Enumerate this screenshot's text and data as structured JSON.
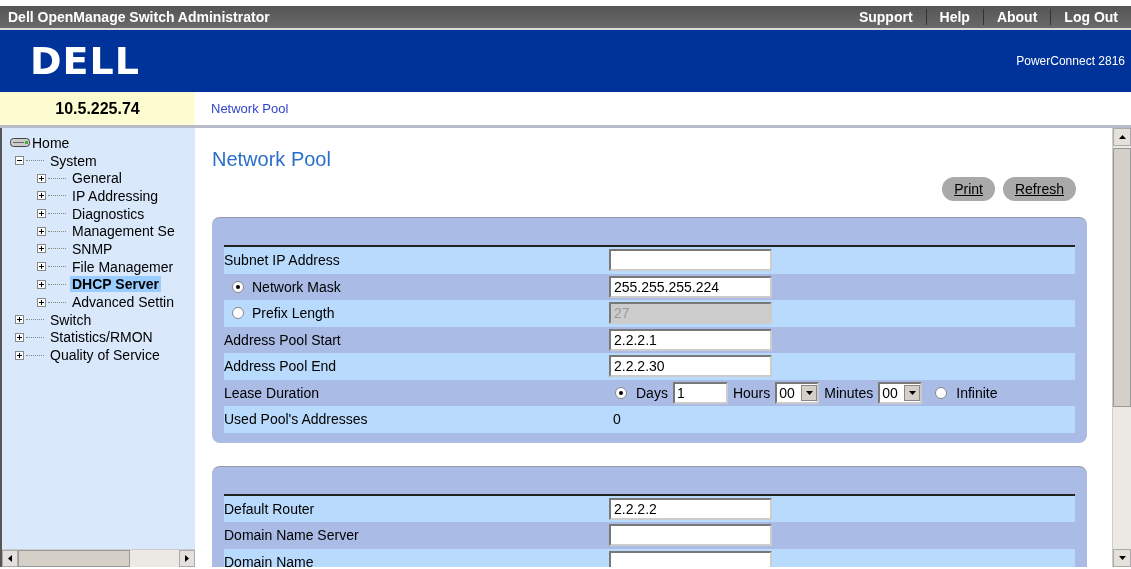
{
  "title_bar": {
    "title": "Dell OpenManage Switch Administrator",
    "links": [
      "Support",
      "Help",
      "About",
      "Log Out"
    ]
  },
  "header": {
    "logo": "DELL",
    "model": "PowerConnect 2816"
  },
  "device_ip": "10.5.225.74",
  "breadcrumb": "Network Pool",
  "tree": {
    "label": "Home",
    "children": [
      {
        "label": "System",
        "expanded": true,
        "selected": false,
        "children": [
          {
            "label": "General",
            "expanded": false,
            "selected": false
          },
          {
            "label": "IP Addressing",
            "expanded": false,
            "selected": false
          },
          {
            "label": "Diagnostics",
            "expanded": false,
            "selected": false
          },
          {
            "label": "Management Se",
            "expanded": false,
            "selected": false
          },
          {
            "label": "SNMP",
            "expanded": false,
            "selected": false
          },
          {
            "label": "File Managemer",
            "expanded": false,
            "selected": false
          },
          {
            "label": "DHCP Server",
            "expanded": false,
            "selected": true
          },
          {
            "label": "Advanced Settin",
            "expanded": false,
            "selected": false
          }
        ]
      },
      {
        "label": "Switch",
        "expanded": false,
        "selected": false
      },
      {
        "label": "Statistics/RMON",
        "expanded": false,
        "selected": false
      },
      {
        "label": "Quality of Service",
        "expanded": false,
        "selected": false
      }
    ]
  },
  "page": {
    "title": "Network Pool",
    "buttons": [
      "Print",
      "Refresh"
    ],
    "sections": [
      {
        "rows": [
          {
            "kind": "text",
            "label": "Subnet IP Address"
          },
          {
            "kind": "radio",
            "label": "Network Mask",
            "selected": true,
            "value": "255.255.255.224",
            "disabled": false
          },
          {
            "kind": "radio",
            "label": "Prefix Length",
            "selected": false,
            "value": "27",
            "disabled": true
          },
          {
            "kind": "text",
            "label": "Address Pool Start",
            "value": "2.2.2.1"
          },
          {
            "kind": "text",
            "label": "Address Pool End",
            "value": "2.2.2.30"
          },
          {
            "kind": "lease",
            "label": "Lease Duration",
            "days_selected": true,
            "days_label": "Days",
            "days": "1",
            "hours_label": "Hours",
            "hours": "00",
            "minutes_label": "Minutes",
            "minutes": "00",
            "infinite_selected": false,
            "infinite_label": "Infinite"
          },
          {
            "kind": "static",
            "label": "Used Pool's Addresses",
            "value": "0"
          }
        ]
      },
      {
        "rows": [
          {
            "kind": "text",
            "label": "Default Router",
            "value": "2.2.2.2"
          },
          {
            "kind": "text",
            "label": "Domain Name Server"
          },
          {
            "kind": "text",
            "label": "Domain Name"
          }
        ]
      }
    ]
  }
}
